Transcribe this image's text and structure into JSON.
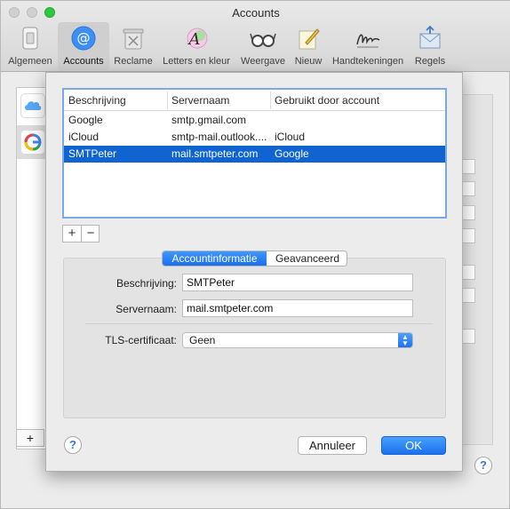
{
  "window": {
    "title": "Accounts"
  },
  "toolbar": {
    "items": [
      {
        "label": "Algemeen",
        "icon": "switch-icon"
      },
      {
        "label": "Accounts",
        "icon": "at-sign-icon",
        "active": true
      },
      {
        "label": "Reclame",
        "icon": "trash-icon"
      },
      {
        "label": "Letters en kleur",
        "icon": "font-color-icon"
      },
      {
        "label": "Weergave",
        "icon": "glasses-icon"
      },
      {
        "label": "Nieuw",
        "icon": "pencil-paper-icon"
      },
      {
        "label": "Handtekeningen",
        "icon": "signature-icon"
      },
      {
        "label": "Regels",
        "icon": "rules-envelope-icon"
      }
    ]
  },
  "smtp_table": {
    "columns": [
      "Beschrijving",
      "Servernaam",
      "Gebruikt door account"
    ],
    "rows": [
      {
        "description": "Google",
        "server": "smtp.gmail.com",
        "used_by": ""
      },
      {
        "description": "iCloud",
        "server": "smtp-mail.outlook....",
        "used_by": "iCloud"
      },
      {
        "description": "SMTPeter",
        "server": "mail.smtpeter.com",
        "used_by": "Google",
        "selected": true
      }
    ]
  },
  "list_controls": {
    "add": "+",
    "remove": "−"
  },
  "tabs": {
    "account_info": "Accountinformatie",
    "advanced": "Geavanceerd",
    "selected": "Accountinformatie"
  },
  "form": {
    "description_label": "Beschrijving:",
    "description_value": "SMTPeter",
    "server_label": "Servernaam:",
    "server_value": "mail.smtpeter.com",
    "tls_label": "TLS-certificaat:",
    "tls_value": "Geen"
  },
  "buttons": {
    "help": "?",
    "cancel": "Annuleer",
    "ok": "OK"
  },
  "background": {
    "add": "+",
    "help": "?"
  },
  "colors": {
    "accent": "#1b70f0",
    "selection": "#0f64d2"
  }
}
